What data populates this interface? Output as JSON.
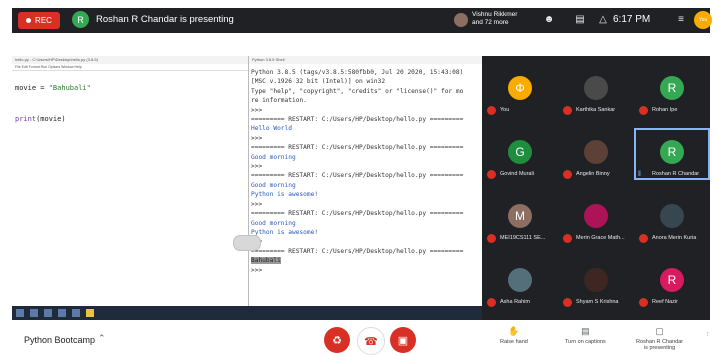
{
  "topbar": {
    "rec_label": "REC",
    "presenter_initial": "R",
    "presenting_text": "Roshan R Chandar is presenting",
    "viewers_name": "Vishnu Rikkmer",
    "viewers_more": "and 72 more",
    "time": "6:17 PM",
    "you_label": "You"
  },
  "notepad": {
    "title": "hello.py - C:\\Users\\HP\\Desktop\\hello.py (3.8.5)",
    "menu": "File  Edit  Format  Run  Options  Window  Help",
    "line1_var": "movie = ",
    "line1_str": "\"Bahubali\"",
    "line2_fn": "print",
    "line2_arg": "(movie)"
  },
  "shell": {
    "title": "Python 3.8.5 Shell",
    "lines": [
      {
        "t": "Python 3.8.5 (tags/v3.8.5:580fbb0, Jul 20 2020, 15:43:08)",
        "c": ""
      },
      {
        "t": "[MSC v.1926 32 bit (Intel)] on win32",
        "c": ""
      },
      {
        "t": "Type \"help\", \"copyright\", \"credits\" or \"license()\" for mo",
        "c": ""
      },
      {
        "t": "re information.",
        "c": ""
      },
      {
        "t": ">>>",
        "c": ""
      },
      {
        "t": "========= RESTART: C:/Users/HP/Desktop/hello.py =========",
        "c": ""
      },
      {
        "t": "Hello World",
        "c": "out"
      },
      {
        "t": ">>>",
        "c": ""
      },
      {
        "t": "========= RESTART: C:/Users/HP/Desktop/hello.py =========",
        "c": ""
      },
      {
        "t": "Good morning",
        "c": "out"
      },
      {
        "t": ">>>",
        "c": ""
      },
      {
        "t": "========= RESTART: C:/Users/HP/Desktop/hello.py =========",
        "c": ""
      },
      {
        "t": "Good morning",
        "c": "out"
      },
      {
        "t": "Python is awesome!",
        "c": "out"
      },
      {
        "t": ">>>",
        "c": ""
      },
      {
        "t": "========= RESTART: C:/Users/HP/Desktop/hello.py =========",
        "c": ""
      },
      {
        "t": "Good morning",
        "c": "out"
      },
      {
        "t": "Python is awesome!",
        "c": "out"
      },
      {
        "t": ">>>",
        "c": ""
      },
      {
        "t": "========= RESTART: C:/Users/HP/Desktop/hello.py =========",
        "c": ""
      },
      {
        "t": "Bahubali",
        "c": "hl"
      },
      {
        "t": ">>>",
        "c": ""
      }
    ]
  },
  "participants": [
    {
      "name": "You",
      "initial": "Φ",
      "color": "#f9ab00"
    },
    {
      "name": "Karthika Sankar",
      "initial": "",
      "color": "#4a4a4a"
    },
    {
      "name": "Rohan Ipe",
      "initial": "R",
      "color": "#34a853"
    },
    {
      "name": "Govind Murali",
      "initial": "G",
      "color": "#1e8e3e"
    },
    {
      "name": "Angelin Binny",
      "initial": "",
      "color": "#5d4037"
    },
    {
      "name": "Roshan R Chandar",
      "initial": "R",
      "color": "#34a853"
    },
    {
      "name": "MEI19CS111 SE...",
      "initial": "M",
      "color": "#8d6e63"
    },
    {
      "name": "Merin Grace Math...",
      "initial": "",
      "color": "#ad1457"
    },
    {
      "name": "Anora Merin Kuria",
      "initial": "",
      "color": "#37474f"
    },
    {
      "name": "Asha Rahim",
      "initial": "",
      "color": "#546e7a"
    },
    {
      "name": "Shyam S Krishna",
      "initial": "",
      "color": "#3e2723"
    },
    {
      "name": "Reef Nazir",
      "initial": "R",
      "color": "#d81b60"
    }
  ],
  "bottom": {
    "meeting_name": "Python Bootcamp",
    "raise_hand": "Raise hand",
    "captions": "Turn on captions",
    "presenting_line1": "Roshan R Chandar",
    "presenting_line2": "is presenting"
  },
  "colors": {
    "danger": "#d93025",
    "dark": "#202124",
    "accent": "#8ab4f8"
  }
}
